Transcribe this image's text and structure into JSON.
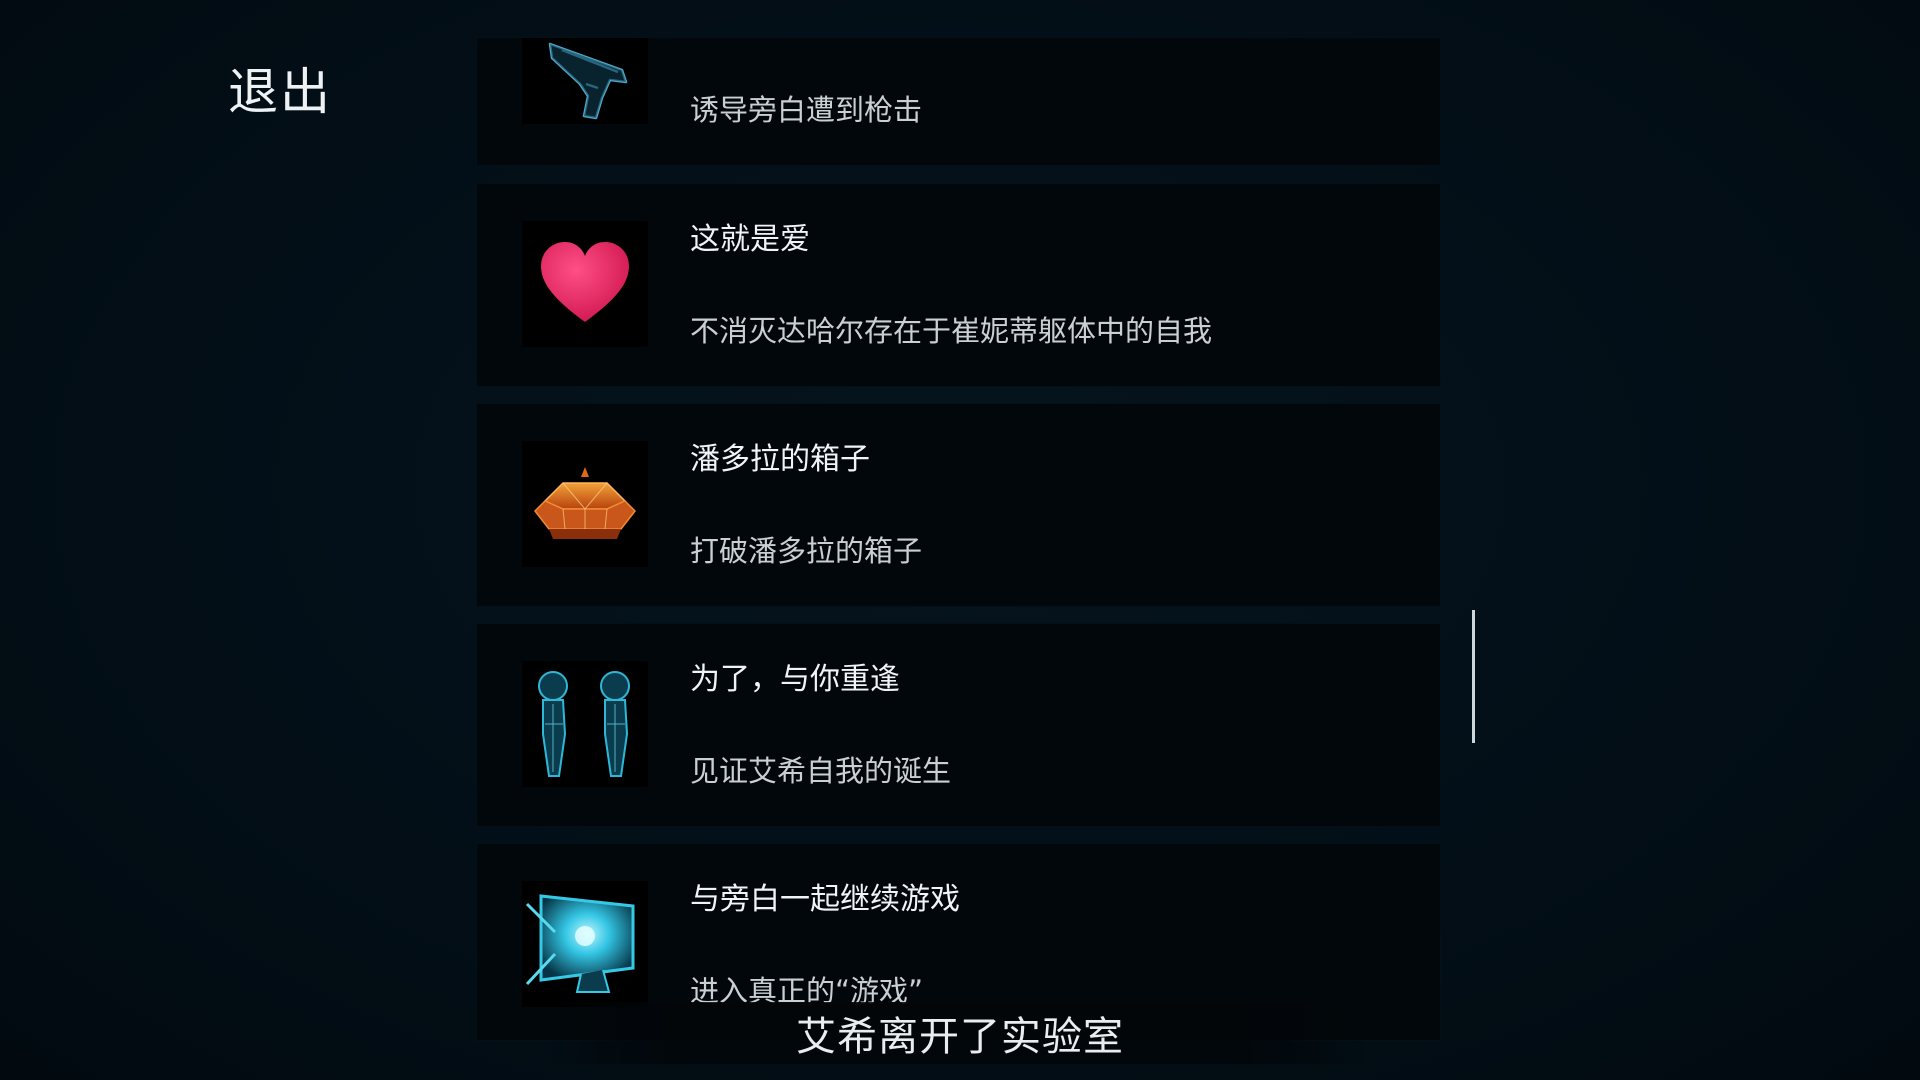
{
  "exit_label": "退出",
  "achievements": [
    {
      "title": "",
      "desc": "诱导旁白遭到枪击",
      "icon": "gun-icon"
    },
    {
      "title": "这就是爱",
      "desc": "不消灭达哈尔存在于崔妮蒂躯体中的自我",
      "icon": "heart-icon"
    },
    {
      "title": "潘多拉的箱子",
      "desc": "打破潘多拉的箱子",
      "icon": "pandora-box-icon"
    },
    {
      "title": "为了，与你重逢",
      "desc": "见证艾希自我的诞生",
      "icon": "twin-figures-icon"
    },
    {
      "title": "与旁白一起继续游戏",
      "desc": "进入真正的“游戏”",
      "icon": "monitor-icon"
    }
  ],
  "subtitle": "艾希离开了实验室",
  "colors": {
    "background": "#030c13",
    "card": "#02070b",
    "heart": "#e0245e",
    "hologram_cyan": "#22c8e6",
    "box_orange": "#e06a1c"
  }
}
